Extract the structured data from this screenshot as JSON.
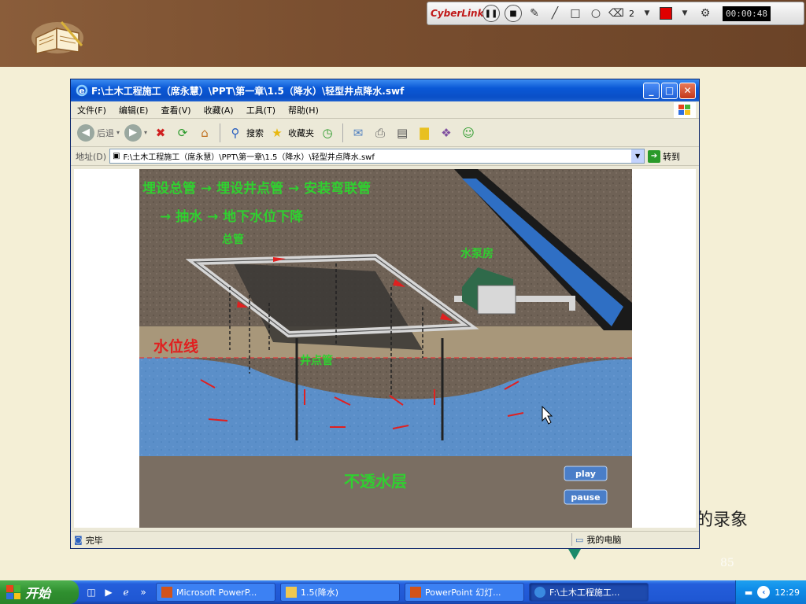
{
  "slide": {
    "side_text": "的录象",
    "page_number": "85"
  },
  "cyberlink": {
    "logo": "CyberLink",
    "pen_width": "2",
    "pen_color": "#e00000",
    "timer": "00:00:48",
    "icons": [
      "pause-icon",
      "stop-icon",
      "pen-icon",
      "line-icon",
      "rectangle-icon",
      "ellipse-icon",
      "eraser-icon",
      "settings-icon"
    ]
  },
  "window": {
    "title": "F:\\土木工程施工（席永慧）\\PPT\\第一章\\1.5（降水）\\轻型井点降水.swf",
    "menu": [
      "文件(F)",
      "编辑(E)",
      "查看(V)",
      "收藏(A)",
      "工具(T)",
      "帮助(H)"
    ],
    "toolbar": {
      "back_label": "后退",
      "search_label": "搜索",
      "favorites_label": "收藏夹"
    },
    "address": {
      "label": "地址(D)",
      "value": "F:\\土木工程施工（席永慧）\\PPT\\第一章\\1.5（降水）\\轻型井点降水.swf",
      "go_label": "转到"
    },
    "status": {
      "left": "完毕",
      "zone": "我的电脑"
    }
  },
  "flash": {
    "step_line1": "埋设总管 → 埋设井点管 → 安装弯联管",
    "step_line2": "→ 抽水 → 地下水位下降",
    "label_main_pipe": "总管",
    "label_pump_house": "水泵房",
    "label_water_line": "水位线",
    "label_well_pipe": "井点管",
    "label_impermeable": "不透水层",
    "play_label": "play",
    "pause_label": "pause"
  },
  "taskbar": {
    "start_label": "开始",
    "tasks": [
      {
        "label": "Microsoft PowerP...",
        "active": false
      },
      {
        "label": "1.5(降水)",
        "active": false
      },
      {
        "label": "PowerPoint 幻灯...",
        "active": false
      },
      {
        "label": "F:\\土木工程施工...",
        "active": true
      }
    ],
    "clock": "12:29"
  }
}
